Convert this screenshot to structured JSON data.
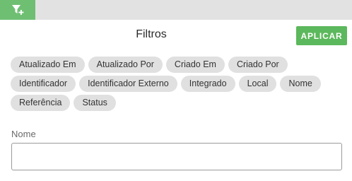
{
  "toolbar": {
    "filter_icon": "filter-add-icon",
    "accent_color": "#6fbf73"
  },
  "panel": {
    "title": "Filtros",
    "apply_label": "APLICAR",
    "apply_color": "#5cb85c"
  },
  "chips": [
    "Atualizado Em",
    "Atualizado Por",
    "Criado Em",
    "Criado Por",
    "Identificador",
    "Identificador Externo",
    "Integrado",
    "Local",
    "Nome",
    "Referência",
    "Status"
  ],
  "field": {
    "label": "Nome",
    "value": ""
  }
}
